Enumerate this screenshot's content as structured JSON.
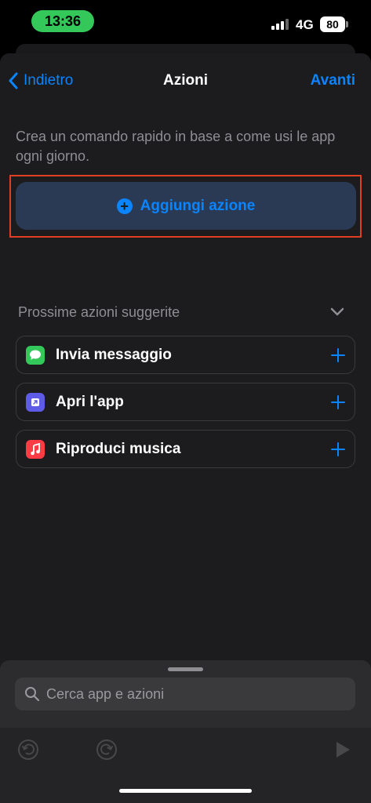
{
  "status": {
    "time": "13:36",
    "network": "4G",
    "battery": "80"
  },
  "nav": {
    "back_label": "Indietro",
    "title": "Azioni",
    "next_label": "Avanti"
  },
  "intro_text": "Crea un comando rapido in base a come usi le app ogni giorno.",
  "add_action_label": "Aggiungi azione",
  "suggestions": {
    "title": "Prossime azioni suggerite",
    "items": [
      {
        "label": "Invia messaggio",
        "icon": "messages-icon",
        "color": "#34c759"
      },
      {
        "label": "Apri l'app",
        "icon": "open-app-icon",
        "color": "#5e5ce6"
      },
      {
        "label": "Riproduci musica",
        "icon": "music-icon",
        "color": "#fc3c44"
      }
    ]
  },
  "search": {
    "placeholder": "Cerca app e azioni"
  },
  "colors": {
    "accent": "#0a84ff",
    "highlight": "#e0401f",
    "background": "#1c1c1e"
  }
}
